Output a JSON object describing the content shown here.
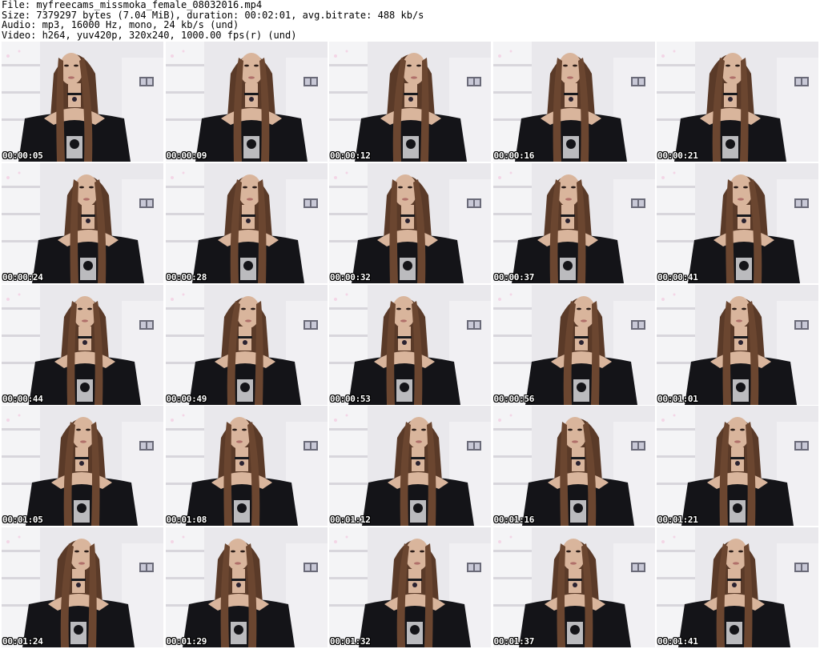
{
  "header": {
    "file": "File: myfreecams_missmoka_female_08032016.mp4",
    "size": "Size: 7379297 bytes (7.04 MiB), duration: 00:02:01, avg.bitrate: 488 kb/s",
    "audio": "Audio: mp3, 16000 Hz, mono, 24 kb/s (und)",
    "video": "Video: h264, yuv420p, 320x240, 1000.00 fps(r) (und)"
  },
  "thumbnails": [
    {
      "time": "00:00:05"
    },
    {
      "time": "00:00:09"
    },
    {
      "time": "00:00:12"
    },
    {
      "time": "00:00:16"
    },
    {
      "time": "00:00:21"
    },
    {
      "time": "00:00:24"
    },
    {
      "time": "00:00:28"
    },
    {
      "time": "00:00:32"
    },
    {
      "time": "00:00:37"
    },
    {
      "time": "00:00:41"
    },
    {
      "time": "00:00:44"
    },
    {
      "time": "00:00:49"
    },
    {
      "time": "00:00:53"
    },
    {
      "time": "00:00:56"
    },
    {
      "time": "00:01:01"
    },
    {
      "time": "00:01:05"
    },
    {
      "time": "00:01:08"
    },
    {
      "time": "00:01:12"
    },
    {
      "time": "00:01:16"
    },
    {
      "time": "00:01:21"
    },
    {
      "time": "00:01:24"
    },
    {
      "time": "00:01:29"
    },
    {
      "time": "00:01:32"
    },
    {
      "time": "00:01:37"
    },
    {
      "time": "00:01:41"
    }
  ],
  "colors": {
    "background": "#ffffff",
    "wall": "#e9e8ec",
    "shelf": "#f4f4f6",
    "hair": "#5a3a28",
    "skin": "#d9b59c",
    "top": "#141418",
    "text": "#000000"
  }
}
